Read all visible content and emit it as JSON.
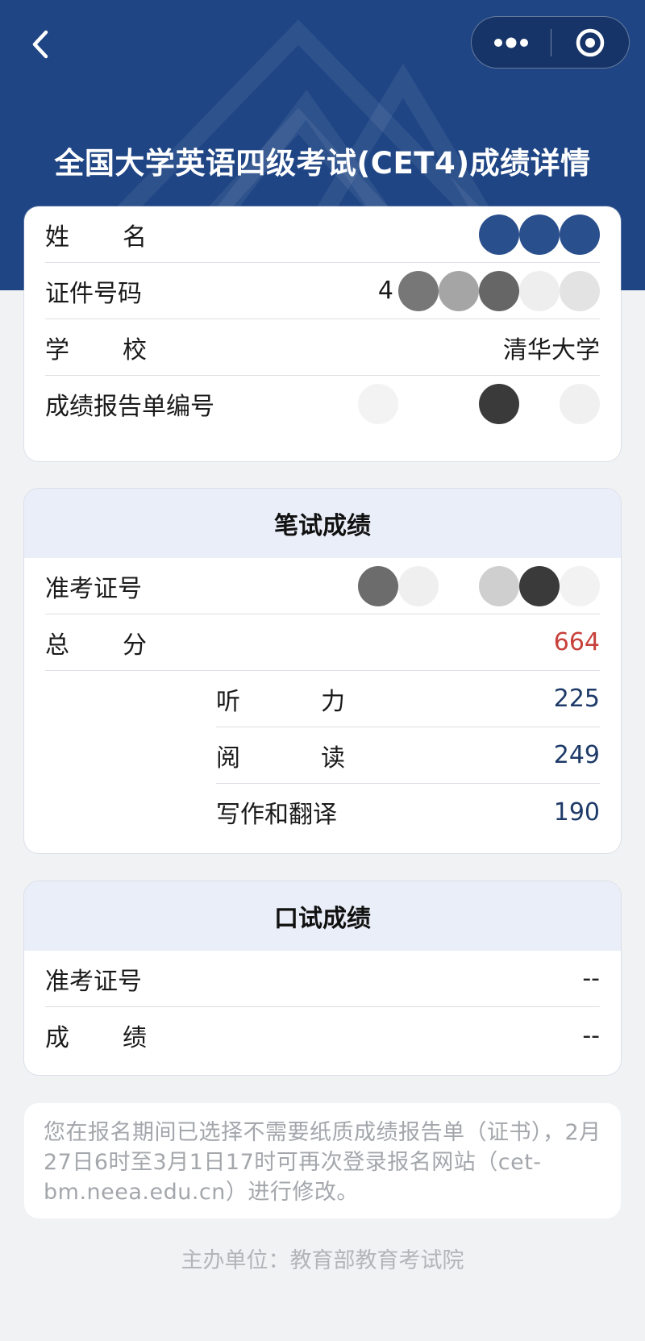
{
  "page_title": "全国大学英语四级考试(CET4)成绩详情",
  "icons": {
    "back": "chevron-left-icon",
    "more": "more-dots-icon",
    "close": "target-close-icon"
  },
  "colors": {
    "header_bg": "#1f4584",
    "card_head_bg": "#e9eef8",
    "total_score": "#c8403a",
    "sub_score": "#1e3a68"
  },
  "profile": {
    "name_label": [
      "姓",
      "名"
    ],
    "id_label": "证件号码",
    "id_value_prefix": "4",
    "school_label": [
      "学",
      "校"
    ],
    "school_value": "清华大学",
    "report_label": "成绩报告单编号"
  },
  "written": {
    "title": "笔试成绩",
    "ticket_label": "准考证号",
    "total_label": [
      "总",
      "分"
    ],
    "total_value": "664",
    "listening_label": [
      "听",
      "力"
    ],
    "listening_value": "225",
    "reading_label": [
      "阅",
      "读"
    ],
    "reading_value": "249",
    "writing_label": "写作和翻译",
    "writing_value": "190"
  },
  "oral": {
    "title": "口试成绩",
    "ticket_label": "准考证号",
    "ticket_value": "--",
    "score_label": [
      "成",
      "绩"
    ],
    "score_value": "--"
  },
  "notice": "您在报名期间已选择不需要纸质成绩报告单（证书），2月27日6时至3月1日17时可再次登录报名网站（cet-bm.neea.edu.cn）进行修改。",
  "footer": "主办单位：教育部教育考试院"
}
